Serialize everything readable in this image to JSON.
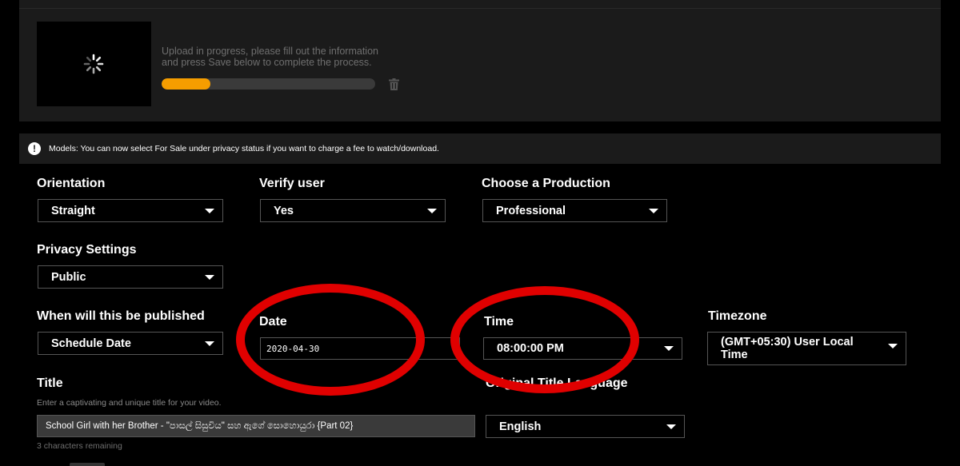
{
  "upload": {
    "message_line1": "Upload in progress, please fill out the information",
    "message_line2": "and press Save below to complete the process.",
    "progress_fraction": 0.23,
    "progress_color": "#f59d00"
  },
  "notice": {
    "icon": "!",
    "text": "Models: You can now select For Sale under privacy status if you want to charge a fee to watch/download."
  },
  "fields": {
    "orientation": {
      "label": "Orientation",
      "value": "Straight"
    },
    "verify_user": {
      "label": "Verify user",
      "value": "Yes"
    },
    "production": {
      "label": "Choose a Production",
      "value": "Professional"
    },
    "privacy": {
      "label": "Privacy Settings",
      "value": "Public"
    },
    "publish": {
      "label": "When will this be published",
      "value": "Schedule Date"
    },
    "date": {
      "label": "Date",
      "value": "2020-04-30"
    },
    "time": {
      "label": "Time",
      "value": "08:00:00 PM"
    },
    "timezone": {
      "label": "Timezone",
      "value_line1": "(GMT+05:30) User Local",
      "value_line2": "Time"
    },
    "title": {
      "label": "Title",
      "hint": "Enter a captivating and unique title for your video.",
      "value": "School Girl with her Brother - \"පාසල් සිසුවිය\" සහ ඇගේ සොහොයුරා {Part 02}",
      "remaining": "3 characters remaining"
    },
    "language": {
      "label": "Original Title Language",
      "value": "English"
    }
  },
  "annotation_color": "#e00000"
}
